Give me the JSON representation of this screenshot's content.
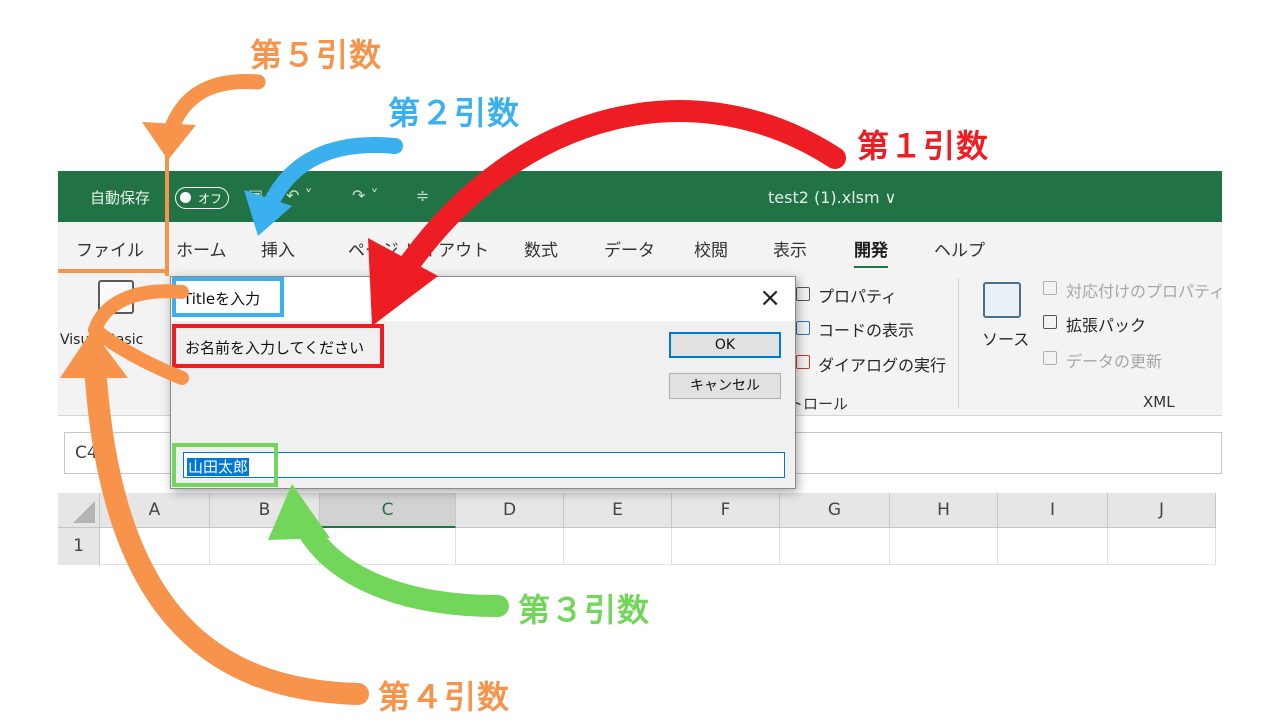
{
  "excel": {
    "titlebar": {
      "autosave_label": "自動保存",
      "autosave_state": "オフ",
      "filename": "test2 (1).xlsm ∨"
    },
    "tabs": [
      {
        "label": "ファイル",
        "active": false
      },
      {
        "label": "ホーム",
        "active": false
      },
      {
        "label": "挿入",
        "active": false
      },
      {
        "label": "ページ レイアウト",
        "active": false
      },
      {
        "label": "数式",
        "active": false
      },
      {
        "label": "データ",
        "active": false
      },
      {
        "label": "校閲",
        "active": false
      },
      {
        "label": "表示",
        "active": false
      },
      {
        "label": "開発",
        "active": true
      },
      {
        "label": "ヘルプ",
        "active": false
      }
    ],
    "ribbon": {
      "vbasic_label": "Visual Basic",
      "controls": {
        "properties": "プロパティ",
        "view_code": "コードの表示",
        "run_dialog": "ダイアログの実行",
        "group_label": "コントロール"
      },
      "xml": {
        "source": "ソース",
        "map_properties": "対応付けのプロパティ",
        "expansion_packs": "拡張パック",
        "refresh_data": "データの更新",
        "group_label": "XML"
      }
    },
    "namebox_value": "C4",
    "columns": [
      "A",
      "B",
      "C",
      "D",
      "E",
      "F",
      "G",
      "H",
      "I",
      "J"
    ],
    "selected_column": "C",
    "rows": [
      "1"
    ]
  },
  "dialog": {
    "title": "Titleを入力",
    "close": "×",
    "prompt": "お名前を入力してください",
    "ok_label": "OK",
    "cancel_label": "キャンセル",
    "input_value": "山田太郎"
  },
  "annotations": {
    "arg1": {
      "label": "第１引数",
      "color": "#ee1d23"
    },
    "arg2": {
      "label": "第２引数",
      "color": "#3ab0ee"
    },
    "arg3": {
      "label": "第３引数",
      "color": "#72d65a"
    },
    "arg4": {
      "label": "第４引数",
      "color": "#f7934a"
    },
    "arg5": {
      "label": "第５引数",
      "color": "#f7934a"
    }
  }
}
